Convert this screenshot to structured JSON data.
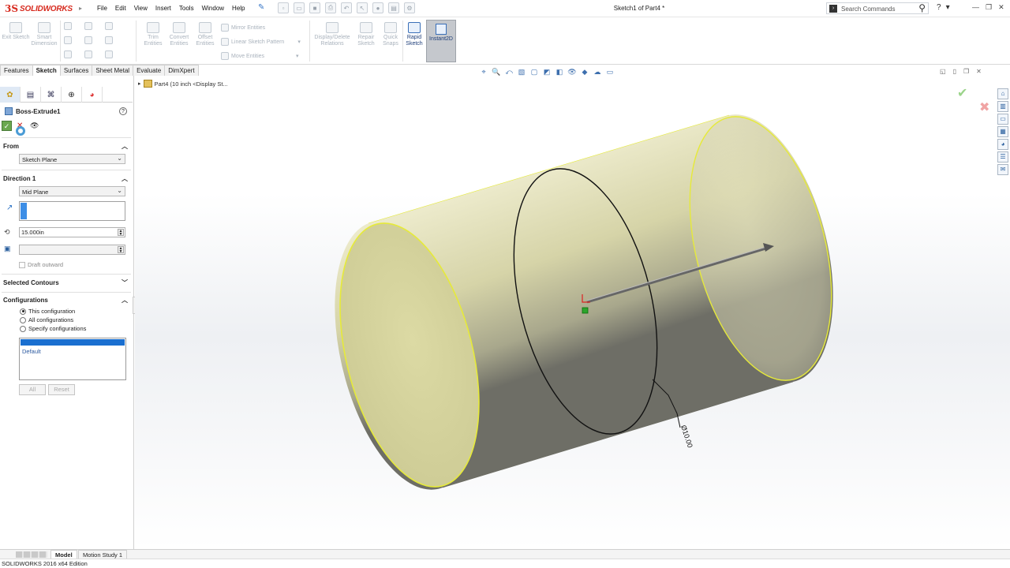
{
  "app": {
    "logo_ds": "3S",
    "logo_text": "SOLIDWORKS",
    "document_title": "Sketch1 of Part4 *"
  },
  "menu": [
    "File",
    "Edit",
    "View",
    "Insert",
    "Tools",
    "Window",
    "Help"
  ],
  "search": {
    "placeholder": "Search Commands"
  },
  "commands": {
    "exit_sketch": "Exit Sketch",
    "smart_dimension": "Smart Dimension",
    "trim_entities": "Trim Entities",
    "convert_entities": "Convert Entities",
    "offset_entities": "Offset Entities",
    "mirror_entities": "Mirror Entities",
    "linear_sketch_pattern": "Linear Sketch Pattern",
    "move_entities": "Move Entities",
    "display_delete_relations": "Display/Delete Relations",
    "repair_sketch": "Repair Sketch",
    "quick_snaps": "Quick Snaps",
    "rapid_sketch": "Rapid Sketch",
    "instant2d": "Instant2D"
  },
  "cm_tabs": [
    {
      "label": "Features",
      "active": false
    },
    {
      "label": "Sketch",
      "active": true
    },
    {
      "label": "Surfaces",
      "active": false
    },
    {
      "label": "Sheet Metal",
      "active": false
    },
    {
      "label": "Evaluate",
      "active": false
    },
    {
      "label": "DimXpert",
      "active": false
    }
  ],
  "property_manager": {
    "title": "Boss-Extrude1",
    "from": {
      "header": "From",
      "value": "Sketch Plane"
    },
    "direction1": {
      "header": "Direction 1",
      "end_condition": "Mid Plane",
      "depth": "15.000in",
      "draft_outward": "Draft outward"
    },
    "selected_contours": {
      "header": "Selected Contours"
    },
    "configurations": {
      "header": "Configurations",
      "options": [
        {
          "label": "This configuration",
          "selected": true
        },
        {
          "label": "All configurations",
          "selected": false
        },
        {
          "label": "Specify configurations",
          "selected": false
        }
      ],
      "list_item": "Default",
      "all_button": "All",
      "reset_button": "Reset"
    }
  },
  "tree_flyout": {
    "label": "Part4  (10 inch <Display St..."
  },
  "dimension_label": "Ø10.00",
  "bottom_tabs": [
    {
      "label": "Model",
      "active": true
    },
    {
      "label": "Motion Study 1",
      "active": false
    }
  ],
  "status": {
    "text": "SOLIDWORKS 2016 x64 Edition"
  }
}
